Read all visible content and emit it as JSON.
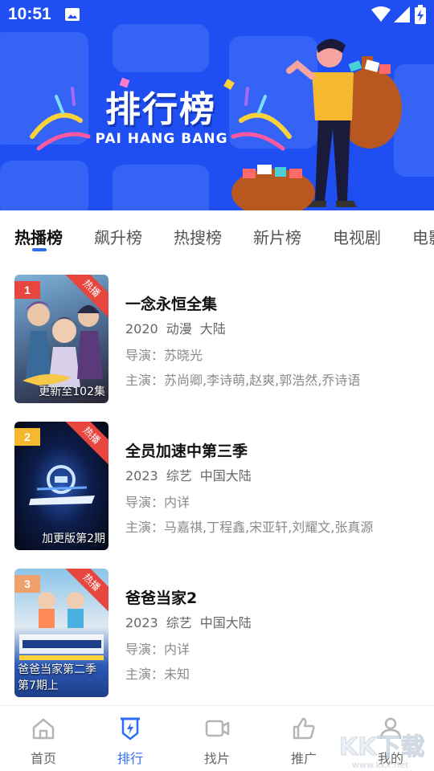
{
  "status_bar": {
    "time": "10:51"
  },
  "banner": {
    "title": "排行榜",
    "subtitle": "PAI HANG BANG"
  },
  "tabs": [
    {
      "label": "热播榜",
      "active": true
    },
    {
      "label": "飙升榜",
      "active": false
    },
    {
      "label": "热搜榜",
      "active": false
    },
    {
      "label": "新片榜",
      "active": false
    },
    {
      "label": "电视剧",
      "active": false
    },
    {
      "label": "电影",
      "active": false
    }
  ],
  "items": [
    {
      "rank": "1",
      "badge": "热播",
      "caption": "更新至102集",
      "title": "一念永恒全集",
      "year": "2020",
      "genre": "动漫",
      "region": "大陆",
      "director": "导演：苏晓光",
      "cast": "主演：苏尚卿,李诗萌,赵爽,郭浩然,乔诗语",
      "rank_color": "#e6463d"
    },
    {
      "rank": "2",
      "badge": "热播",
      "caption": "加更版第2期",
      "title": "全员加速中第三季",
      "year": "2023",
      "genre": "综艺",
      "region": "中国大陆",
      "director": "导演：内详",
      "cast": "主演：马嘉祺,丁程鑫,宋亚轩,刘耀文,张真源",
      "rank_color": "#f5b82e"
    },
    {
      "rank": "3",
      "badge": "热播",
      "caption": "爸爸当家第二季第7期上",
      "title": "爸爸当家2",
      "year": "2023",
      "genre": "综艺",
      "region": "中国大陆",
      "director": "导演：内详",
      "cast": "主演：未知",
      "rank_color": "#f0a06a"
    }
  ],
  "bottom_nav": [
    {
      "label": "首页",
      "icon": "home-icon",
      "active": false
    },
    {
      "label": "排行",
      "icon": "ranking-icon",
      "active": true
    },
    {
      "label": "找片",
      "icon": "video-camera-icon",
      "active": false
    },
    {
      "label": "推广",
      "icon": "thumbs-up-icon",
      "active": false
    },
    {
      "label": "我的",
      "icon": "user-icon",
      "active": false
    }
  ],
  "watermark": "KK下载",
  "colors": {
    "banner_blue": "#1f4ff2",
    "accent": "#2d6df6",
    "hot_red": "#e6463d"
  }
}
